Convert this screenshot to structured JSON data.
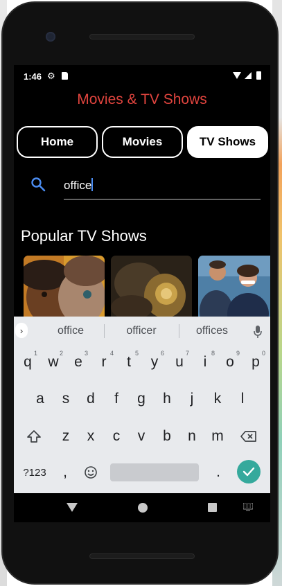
{
  "status_bar": {
    "time": "1:46"
  },
  "app": {
    "title": "Movies & TV Shows"
  },
  "tabs": [
    {
      "label": "Home",
      "active": false
    },
    {
      "label": "Movies",
      "active": false
    },
    {
      "label": "TV Shows",
      "active": true
    }
  ],
  "search": {
    "value": "office",
    "placeholder": ""
  },
  "section": {
    "title": "Popular TV Shows"
  },
  "keyboard": {
    "suggestions": [
      "office",
      "officer",
      "offices"
    ],
    "row1": [
      {
        "key": "q",
        "hint": "1"
      },
      {
        "key": "w",
        "hint": "2"
      },
      {
        "key": "e",
        "hint": "3"
      },
      {
        "key": "r",
        "hint": "4"
      },
      {
        "key": "t",
        "hint": "5"
      },
      {
        "key": "y",
        "hint": "6"
      },
      {
        "key": "u",
        "hint": "7"
      },
      {
        "key": "i",
        "hint": "8"
      },
      {
        "key": "o",
        "hint": "9"
      },
      {
        "key": "p",
        "hint": "0"
      }
    ],
    "row2": [
      "a",
      "s",
      "d",
      "f",
      "g",
      "h",
      "j",
      "k",
      "l"
    ],
    "row3": [
      "z",
      "x",
      "c",
      "v",
      "b",
      "n",
      "m"
    ],
    "symbols_label": "?123",
    "comma_label": ",",
    "period_label": "."
  },
  "colors": {
    "title_red": "#e0443e",
    "search_icon_blue": "#4b8cf0",
    "enter_key_teal": "#35a99c",
    "keyboard_bg": "#e8eaed"
  }
}
